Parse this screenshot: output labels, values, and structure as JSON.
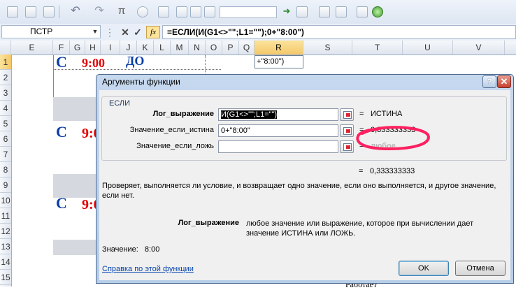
{
  "qat": {
    "icons": [
      "checkbox-icon",
      "table-icon",
      "grid-icon",
      "undo-icon",
      "redo-icon",
      "pi-icon",
      "function-icon",
      "image-icon",
      "camera-icon",
      "shapes-icon",
      "go-arrow-icon",
      "paste-icon",
      "delete-icon",
      "copy-icon",
      "form-icon",
      "circle-icon"
    ],
    "undo_glyph": "↶",
    "redo_glyph": "↷",
    "pi_glyph": "π",
    "arrow_glyph": "➜"
  },
  "formula_bar": {
    "name_box": "ПСТР",
    "cancel_glyph": "✕",
    "enter_glyph": "✓",
    "fx_label": "fx",
    "formula": "=ЕСЛИ(И(G1<>\"\";L1=\"\");0+\"8:00\")"
  },
  "columns": [
    "E",
    "F",
    "G",
    "H",
    "I",
    "J",
    "K",
    "L",
    "M",
    "N",
    "O",
    "P",
    "Q",
    "R",
    "S",
    "T",
    "U",
    "V"
  ],
  "active_column": "R",
  "rows": [
    "1",
    "2",
    "3",
    "4",
    "5",
    "6",
    "7",
    "8",
    "9",
    "10",
    "11",
    "12",
    "13",
    "14",
    "15"
  ],
  "sheet": {
    "c_glyph": "С",
    "time_full": "9:00",
    "time_partial": "9:0",
    "do_label": "ДО",
    "cell_r1": "+\"8:00\")",
    "behind_text": "Работает"
  },
  "dialog": {
    "title": "Аргументы функции",
    "help_glyph": "?",
    "close_glyph": "✕",
    "group_label": "ЕСЛИ",
    "args": [
      {
        "label": "Лог_выражение",
        "value": "И(G1<>\"\";L1=\"\")",
        "result": "ИСТИНА",
        "bold": true
      },
      {
        "label": "Значение_если_истина",
        "value": "0+\"8:00\"",
        "result": "0,333333333",
        "bold": false
      },
      {
        "label": "Значение_если_ложь",
        "value": "",
        "result": "любое",
        "bold": false
      }
    ],
    "eq": "=",
    "total_result": "0,333333333",
    "description": "Проверяет, выполняется ли условие, и возвращает одно значение, если оно выполняется, и другое значение, если нет.",
    "arg_name": "Лог_выражение",
    "arg_description": "любое значение или выражение, которое при вычислении дает значение ИСТИНА или ЛОЖЬ.",
    "value_label": "Значение:",
    "value": "8:00",
    "help_link": "Справка по этой функции",
    "ok": "OK",
    "cancel": "Отмена"
  },
  "colors": {
    "highlight_circle": "#ff2060",
    "time_red": "#e00000",
    "c_blue": "#0a3ea8"
  }
}
